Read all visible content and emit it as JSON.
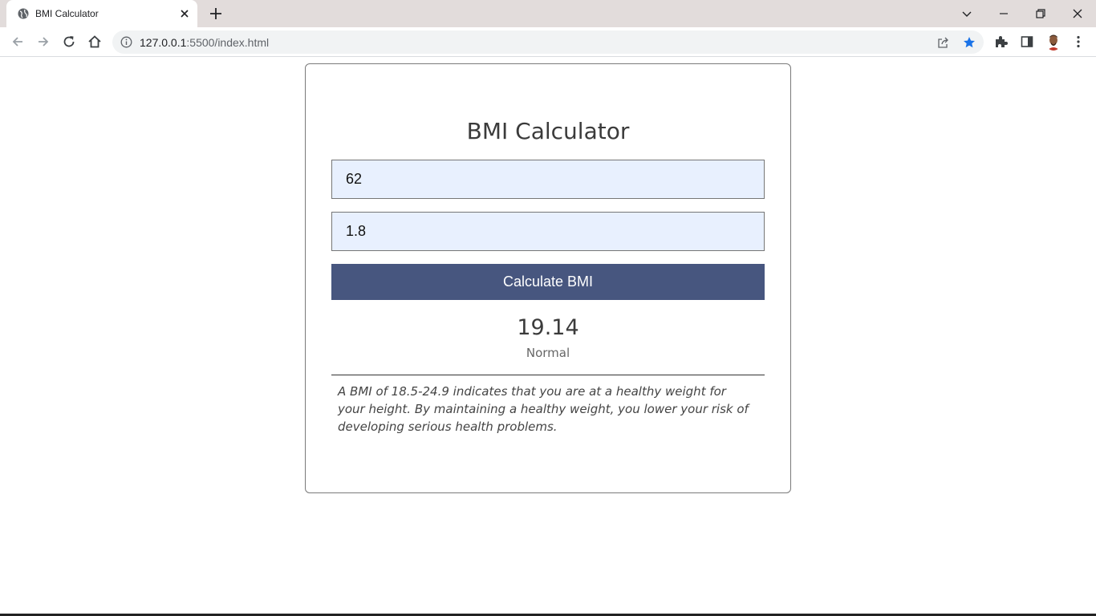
{
  "browser": {
    "tab_title": "BMI Calculator",
    "url_host": "127.0.0.1",
    "url_path": ":5500/index.html"
  },
  "app": {
    "title": "BMI Calculator",
    "weight_value": "62",
    "height_value": "1.8",
    "calculate_label": "Calculate BMI",
    "bmi_value": "19.14",
    "bmi_category": "Normal",
    "description": "A BMI of 18.5-24.9 indicates that you are at a healthy weight for your height. By maintaining a healthy weight, you lower your risk of developing serious health problems."
  },
  "colors": {
    "button": "#47567f",
    "input_bg": "#e8f0fe",
    "star": "#1a73e8"
  }
}
